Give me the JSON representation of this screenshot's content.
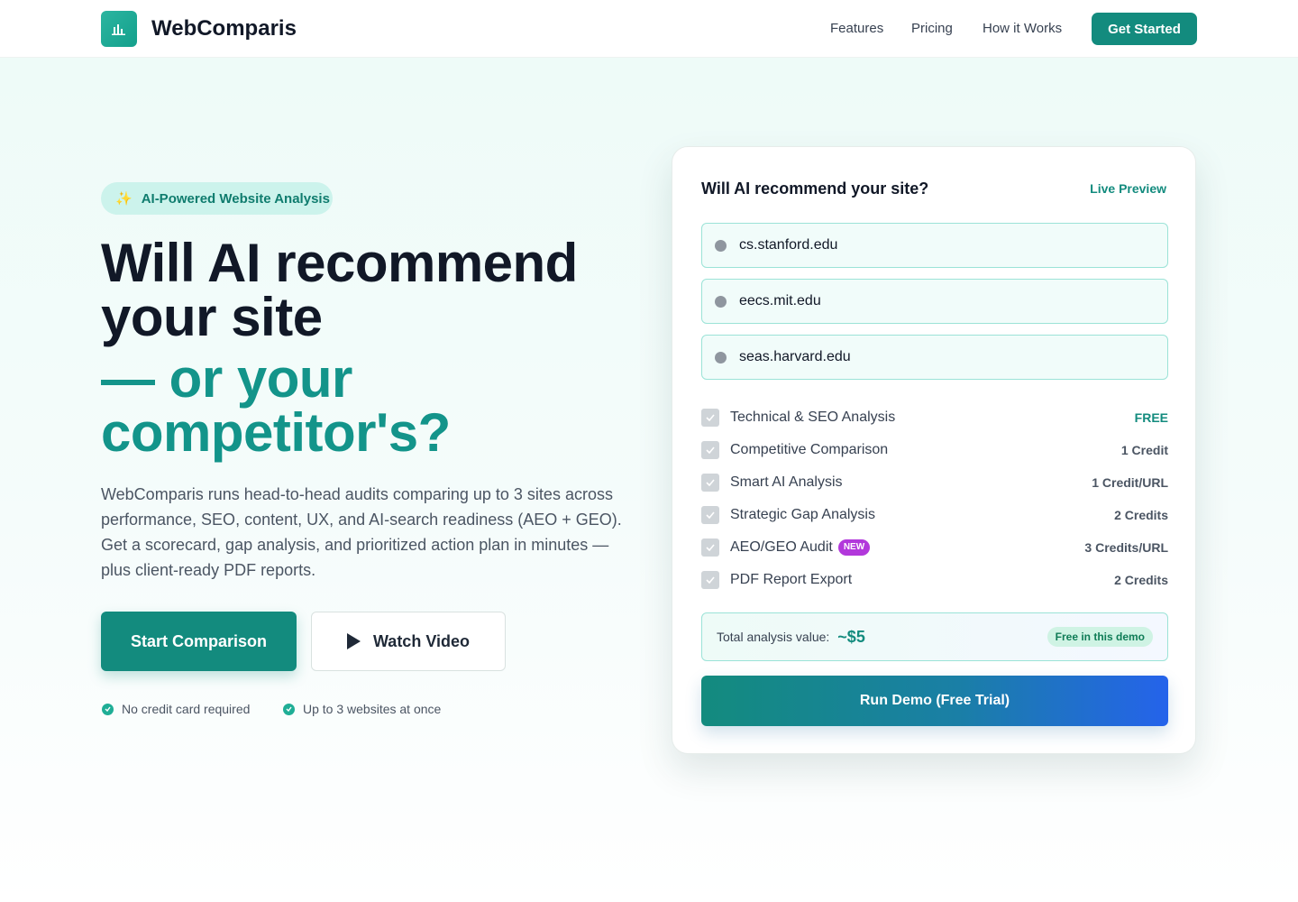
{
  "header": {
    "brand": "WebComparis",
    "nav": [
      "Features",
      "Pricing",
      "How it Works"
    ],
    "cta": "Get Started"
  },
  "hero": {
    "badge": "AI-Powered Website Analysis",
    "title_line1": "Will AI recommend",
    "title_line2": "your site",
    "title_line3": "— or your",
    "title_line4": "competitor's?",
    "lead": "WebComparis runs head-to-head audits comparing up to 3 sites across performance, SEO, content, UX, and AI-search readiness (AEO + GEO). Get a scorecard, gap analysis, and prioritized action plan in minutes — plus client-ready PDF reports.",
    "primary_button": "Start Comparison",
    "secondary_button": "Watch Video",
    "perks": [
      "No credit card required",
      "Up to 3 websites at once"
    ]
  },
  "card": {
    "title": "Will AI recommend your site?",
    "live_label": "Live Preview",
    "urls": [
      "cs.stanford.edu",
      "eecs.mit.edu",
      "seas.harvard.edu"
    ],
    "features": [
      {
        "label": "Technical & SEO Analysis",
        "price": "FREE"
      },
      {
        "label": "Competitive Comparison",
        "price": "1 Credit"
      },
      {
        "label": "Smart AI Analysis",
        "price": "1 Credit/URL"
      },
      {
        "label": "Strategic Gap Analysis",
        "price": "2 Credits"
      },
      {
        "label": "AEO/GEO Audit",
        "price": "3 Credits/URL",
        "badge": "NEW"
      },
      {
        "label": "PDF Report Export",
        "price": "2 Credits"
      }
    ],
    "total_label": "Total analysis value:",
    "total_value": "~$5",
    "total_badge": "Free in this demo",
    "run_button": "Run Demo (Free Trial)"
  },
  "colors": {
    "accent": "#138b7e",
    "accent_light": "#ccf3ec",
    "new_badge": "#b238db",
    "gradient_end": "#2563eb"
  },
  "icons": {
    "logo": "bar-chart-icon",
    "badge": "sparkles-icon",
    "play": "play-icon",
    "check": "check-circle-icon",
    "globe": "globe-icon",
    "checkbox": "checkbox-checked-icon"
  }
}
